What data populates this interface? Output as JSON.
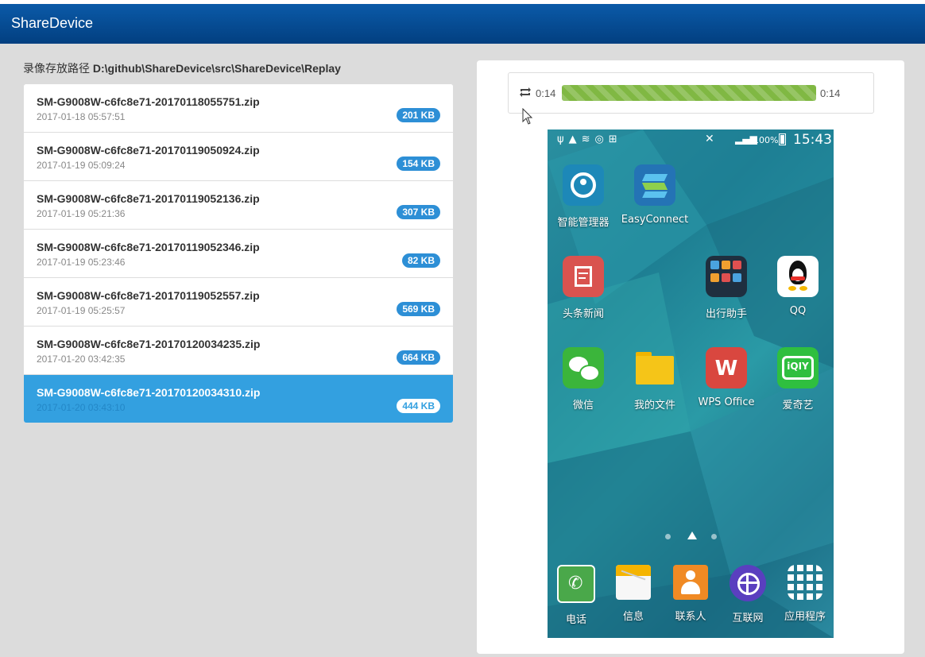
{
  "app": {
    "title": "ShareDevice"
  },
  "path": {
    "label": "录像存放路径",
    "value": "D:\\github\\ShareDevice\\src\\ShareDevice\\Replay"
  },
  "files": [
    {
      "name": "SM-G9008W-c6fc8e71-20170118055751.zip",
      "date": "2017-01-18 05:57:51",
      "size": "201 KB"
    },
    {
      "name": "SM-G9008W-c6fc8e71-20170119050924.zip",
      "date": "2017-01-19 05:09:24",
      "size": "154 KB"
    },
    {
      "name": "SM-G9008W-c6fc8e71-20170119052136.zip",
      "date": "2017-01-19 05:21:36",
      "size": "307 KB"
    },
    {
      "name": "SM-G9008W-c6fc8e71-20170119052346.zip",
      "date": "2017-01-19 05:23:46",
      "size": "82 KB"
    },
    {
      "name": "SM-G9008W-c6fc8e71-20170119052557.zip",
      "date": "2017-01-19 05:25:57",
      "size": "569 KB"
    },
    {
      "name": "SM-G9008W-c6fc8e71-20170120034235.zip",
      "date": "2017-01-20 03:42:35",
      "size": "664 KB"
    },
    {
      "name": "SM-G9008W-c6fc8e71-20170120034310.zip",
      "date": "2017-01-20 03:43:10",
      "size": "444 KB",
      "selected": true
    }
  ],
  "player": {
    "current_time": "0:14",
    "total_time": "0:14",
    "progress": 1.0,
    "progress_color": "#80b843",
    "replay_icon": "replay-icon"
  },
  "phone": {
    "status": {
      "battery": "100%",
      "time": "15:43"
    },
    "apps": [
      {
        "label": "智能管理器",
        "icon": "smart-manager-icon"
      },
      {
        "label": "EasyConnect",
        "icon": "easyconnect-icon"
      },
      {
        "label": "头条新闻",
        "icon": "news-icon"
      },
      {
        "label": "出行助手",
        "icon": "travel-assistant-icon"
      },
      {
        "label": "QQ",
        "icon": "qq-icon"
      },
      {
        "label": "微信",
        "icon": "wechat-icon"
      },
      {
        "label": "我的文件",
        "icon": "my-files-icon"
      },
      {
        "label": "WPS Office",
        "icon": "wps-office-icon"
      },
      {
        "label": "爱奇艺",
        "icon": "iqiyi-icon"
      }
    ],
    "dock": [
      {
        "label": "电话",
        "icon": "phone-icon"
      },
      {
        "label": "信息",
        "icon": "messages-icon"
      },
      {
        "label": "联系人",
        "icon": "contacts-icon"
      },
      {
        "label": "互联网",
        "icon": "internet-icon"
      },
      {
        "label": "应用程序",
        "icon": "apps-grid-icon"
      }
    ]
  },
  "colors": {
    "navbar": "#0b5aa8",
    "active_item": "#33a0e0",
    "badge": "#2d8fd6"
  }
}
